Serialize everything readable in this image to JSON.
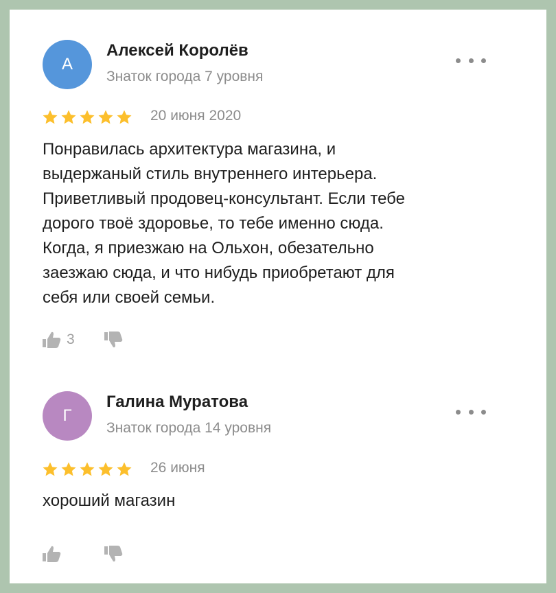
{
  "colors": {
    "background": "#aec5af",
    "star": "#fcbf2c",
    "muted": "#8c8c8c",
    "vote_icon": "#b3b3b3",
    "avatar_a": "#5596db",
    "avatar_g": "#b888c1"
  },
  "reviews": [
    {
      "avatar_letter": "А",
      "author": "Алексей Королёв",
      "level": "Знаток города 7 уровня",
      "rating": 5,
      "date": "20 июня 2020",
      "text_lines": [
        "Понравилась архитектура магазина, и",
        "выдержаный стиль внутреннего интерьера.",
        "Приветливый продовец-консультант. Если тебе",
        "дорого твоё здоровье, то тебе именно сюда.",
        "Когда, я приезжаю на Ольхон, обезательно",
        "заезжаю сюда, и что нибудь приобретают для",
        "себя или своей семьи."
      ],
      "likes": "3"
    },
    {
      "avatar_letter": "Г",
      "author": "Галина Муратова",
      "level": "Знаток города 14 уровня",
      "rating": 5,
      "date": "26 июня",
      "text_lines": [
        "хороший магазин"
      ],
      "likes": ""
    }
  ]
}
